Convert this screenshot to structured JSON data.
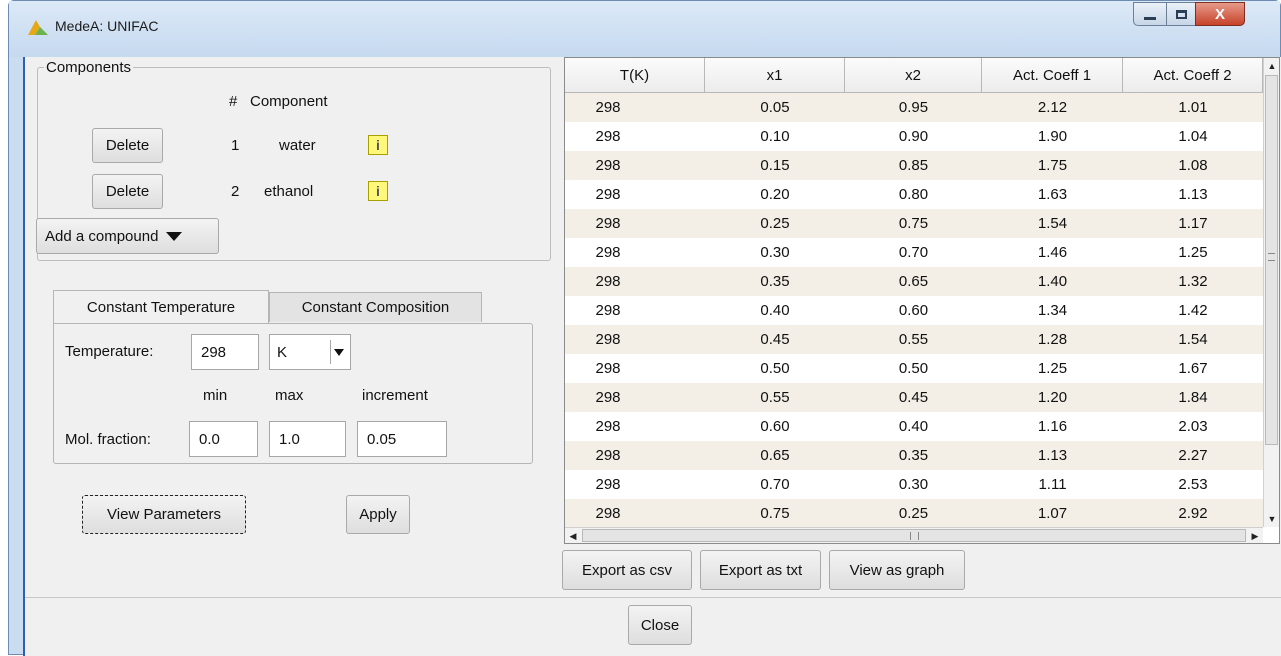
{
  "window": {
    "title": "MedeA: UNIFAC",
    "minimize_label": "—",
    "maximize_label": "□",
    "close_label": "X"
  },
  "components": {
    "group_label": "Components",
    "header_num": "#",
    "header_component": "Component",
    "rows": [
      {
        "delete_label": "Delete",
        "num": "1",
        "name": "water",
        "info": "i"
      },
      {
        "delete_label": "Delete",
        "num": "2",
        "name": "ethanol",
        "info": "i"
      }
    ],
    "add_label": "Add a compound"
  },
  "tabs": {
    "constant_temperature": "Constant Temperature",
    "constant_composition": "Constant Composition"
  },
  "params": {
    "temperature_label": "Temperature:",
    "temperature_value": "298",
    "unit_value": "K",
    "col_min": "min",
    "col_max": "max",
    "col_increment": "increment",
    "molfrac_label": "Mol. fraction:",
    "min_value": "0.0",
    "max_value": "1.0",
    "increment_value": "0.05"
  },
  "buttons": {
    "view_parameters": "View Parameters",
    "apply": "Apply",
    "export_csv": "Export as csv",
    "export_txt": "Export as txt",
    "view_graph": "View as graph",
    "close": "Close"
  },
  "table": {
    "headers": [
      "T(K)",
      "x1",
      "x2",
      "Act. Coeff 1",
      "Act. Coeff 2"
    ],
    "rows": [
      [
        "298",
        "0.05",
        "0.95",
        "2.12",
        "1.01"
      ],
      [
        "298",
        "0.10",
        "0.90",
        "1.90",
        "1.04"
      ],
      [
        "298",
        "0.15",
        "0.85",
        "1.75",
        "1.08"
      ],
      [
        "298",
        "0.20",
        "0.80",
        "1.63",
        "1.13"
      ],
      [
        "298",
        "0.25",
        "0.75",
        "1.54",
        "1.17"
      ],
      [
        "298",
        "0.30",
        "0.70",
        "1.46",
        "1.25"
      ],
      [
        "298",
        "0.35",
        "0.65",
        "1.40",
        "1.32"
      ],
      [
        "298",
        "0.40",
        "0.60",
        "1.34",
        "1.42"
      ],
      [
        "298",
        "0.45",
        "0.55",
        "1.28",
        "1.54"
      ],
      [
        "298",
        "0.50",
        "0.50",
        "1.25",
        "1.67"
      ],
      [
        "298",
        "0.55",
        "0.45",
        "1.20",
        "1.84"
      ],
      [
        "298",
        "0.60",
        "0.40",
        "1.16",
        "2.03"
      ],
      [
        "298",
        "0.65",
        "0.35",
        "1.13",
        "2.27"
      ],
      [
        "298",
        "0.70",
        "0.30",
        "1.11",
        "2.53"
      ],
      [
        "298",
        "0.75",
        "0.25",
        "1.07",
        "2.92"
      ]
    ]
  },
  "colors": {
    "window_frame": "#c9dcf0",
    "info_icon": "#fff87a",
    "row_alt": "#f4efe6"
  }
}
